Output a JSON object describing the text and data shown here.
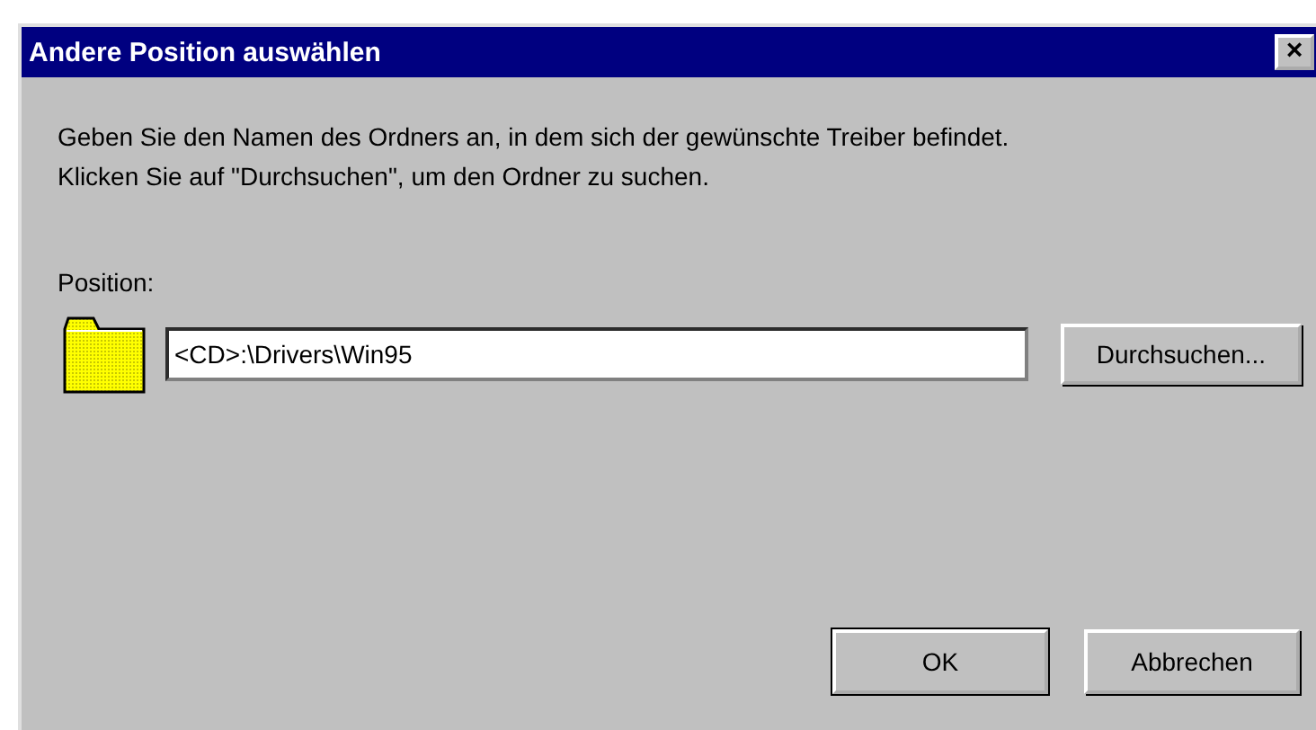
{
  "window": {
    "title": "Andere Position auswählen",
    "close": "×"
  },
  "instructions": [
    "Geben Sie den Namen des Ordners an, in dem sich der gewünschte Treiber befindet.",
    "Klicken Sie auf \"Durchsuchen\", um den Ordner zu suchen."
  ],
  "position": {
    "label": "Position:",
    "value": "<CD>:\\Drivers\\Win95",
    "browse": "Durchsuchen..."
  },
  "buttons": [
    {
      "label": "OK",
      "default": true
    },
    {
      "label": "Abbrechen",
      "default": false
    }
  ]
}
